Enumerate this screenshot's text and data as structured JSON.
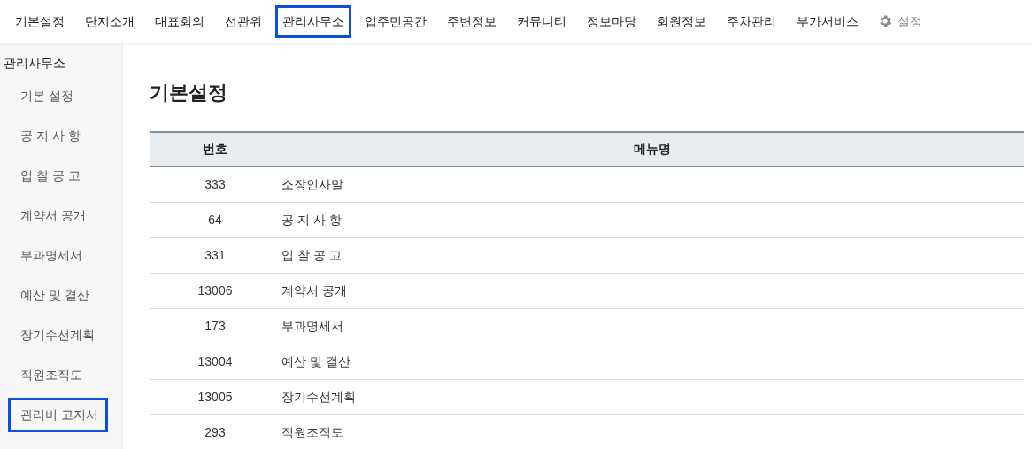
{
  "top_nav": [
    {
      "label": "기본설정",
      "highlighted": false
    },
    {
      "label": "단지소개",
      "highlighted": false
    },
    {
      "label": "대표회의",
      "highlighted": false
    },
    {
      "label": "선관위",
      "highlighted": false
    },
    {
      "label": "관리사무소",
      "highlighted": true
    },
    {
      "label": "입주민공간",
      "highlighted": false
    },
    {
      "label": "주변정보",
      "highlighted": false
    },
    {
      "label": "커뮤니티",
      "highlighted": false
    },
    {
      "label": "정보마당",
      "highlighted": false
    },
    {
      "label": "회원정보",
      "highlighted": false
    },
    {
      "label": "주차관리",
      "highlighted": false
    },
    {
      "label": "부가서비스",
      "highlighted": false
    }
  ],
  "settings_link": {
    "label": "설정"
  },
  "sidebar": {
    "title": "관리사무소",
    "items": [
      {
        "label": "기본 설정",
        "highlighted": false
      },
      {
        "label": "공 지 사 항",
        "highlighted": false
      },
      {
        "label": "입 찰 공 고",
        "highlighted": false
      },
      {
        "label": "계약서 공개",
        "highlighted": false
      },
      {
        "label": "부과명세서",
        "highlighted": false
      },
      {
        "label": "예산 및 결산",
        "highlighted": false
      },
      {
        "label": "장기수선계획",
        "highlighted": false
      },
      {
        "label": "직원조직도",
        "highlighted": false
      },
      {
        "label": "관리비 고지서",
        "highlighted": true
      }
    ]
  },
  "page_title": "기본설정",
  "table": {
    "columns": [
      "번호",
      "메뉴명"
    ],
    "rows": [
      [
        "333",
        "소장인사말"
      ],
      [
        "64",
        "공 지 사 항"
      ],
      [
        "331",
        "입 찰 공 고"
      ],
      [
        "13006",
        "계약서 공개"
      ],
      [
        "173",
        "부과명세서"
      ],
      [
        "13004",
        "예산 및 결산"
      ],
      [
        "13005",
        "장기수선계획"
      ],
      [
        "293",
        "직원조직도"
      ]
    ]
  }
}
